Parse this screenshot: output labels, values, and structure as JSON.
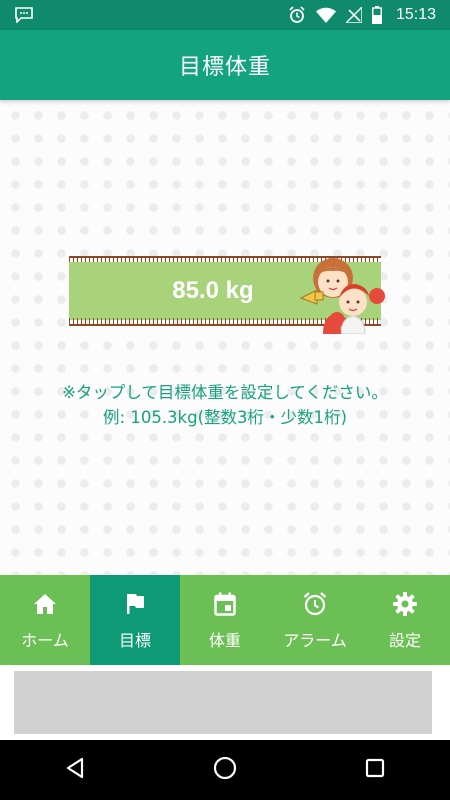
{
  "status_bar": {
    "time": "15:13"
  },
  "app_bar": {
    "title": "目標体重"
  },
  "goal": {
    "weight_display": "85.0 kg"
  },
  "hint": {
    "line1": "※タップして目標体重を設定してください。",
    "line2": "例: 105.3kg(整数3桁・少数1桁)"
  },
  "bottom_nav": {
    "active": "目標",
    "items": [
      {
        "label": "ホーム",
        "icon": "home-icon"
      },
      {
        "label": "目標",
        "icon": "flag-icon"
      },
      {
        "label": "体重",
        "icon": "calendar-icon"
      },
      {
        "label": "アラーム",
        "icon": "alarm-icon"
      },
      {
        "label": "設定",
        "icon": "gear-icon"
      }
    ]
  },
  "colors": {
    "status_bar": "#0f8a6a",
    "app_bar": "#14a37f",
    "accent_text": "#17a27f",
    "banner_fill": "#a9d37b",
    "nav_bg": "#6cbf55",
    "nav_active": "#0f9a76"
  }
}
